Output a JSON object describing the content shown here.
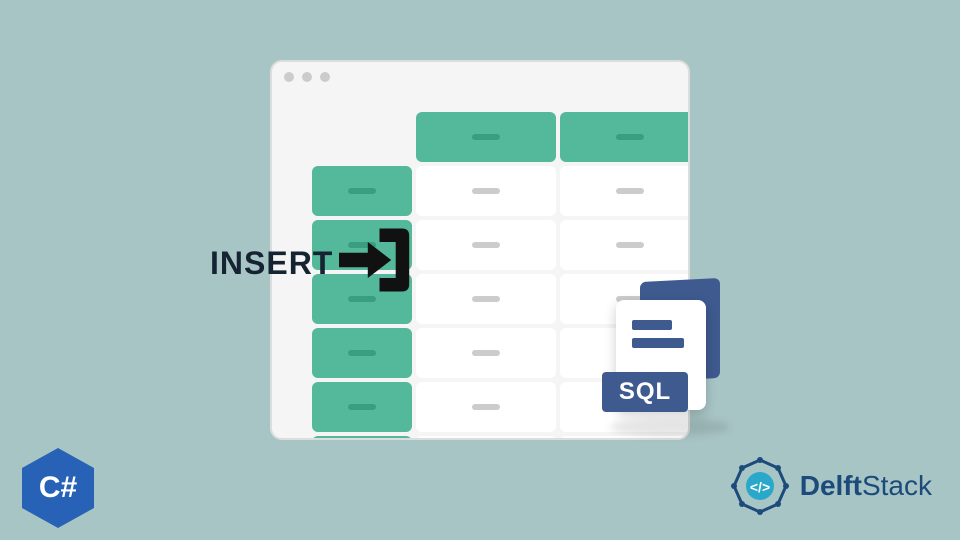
{
  "insert_label": "INSERT",
  "sql_badge": "SQL",
  "csharp_label": "C#",
  "brand": {
    "prefix": "Delft",
    "suffix": "Stack"
  },
  "colors": {
    "background": "#a8c5c5",
    "table_green": "#54b89a",
    "dark_green": "#3a9d7f",
    "sql_blue": "#3e5a8f",
    "csharp_blue": "#2762b6",
    "brand_text": "#1c4a7a",
    "ink": "#152332"
  }
}
